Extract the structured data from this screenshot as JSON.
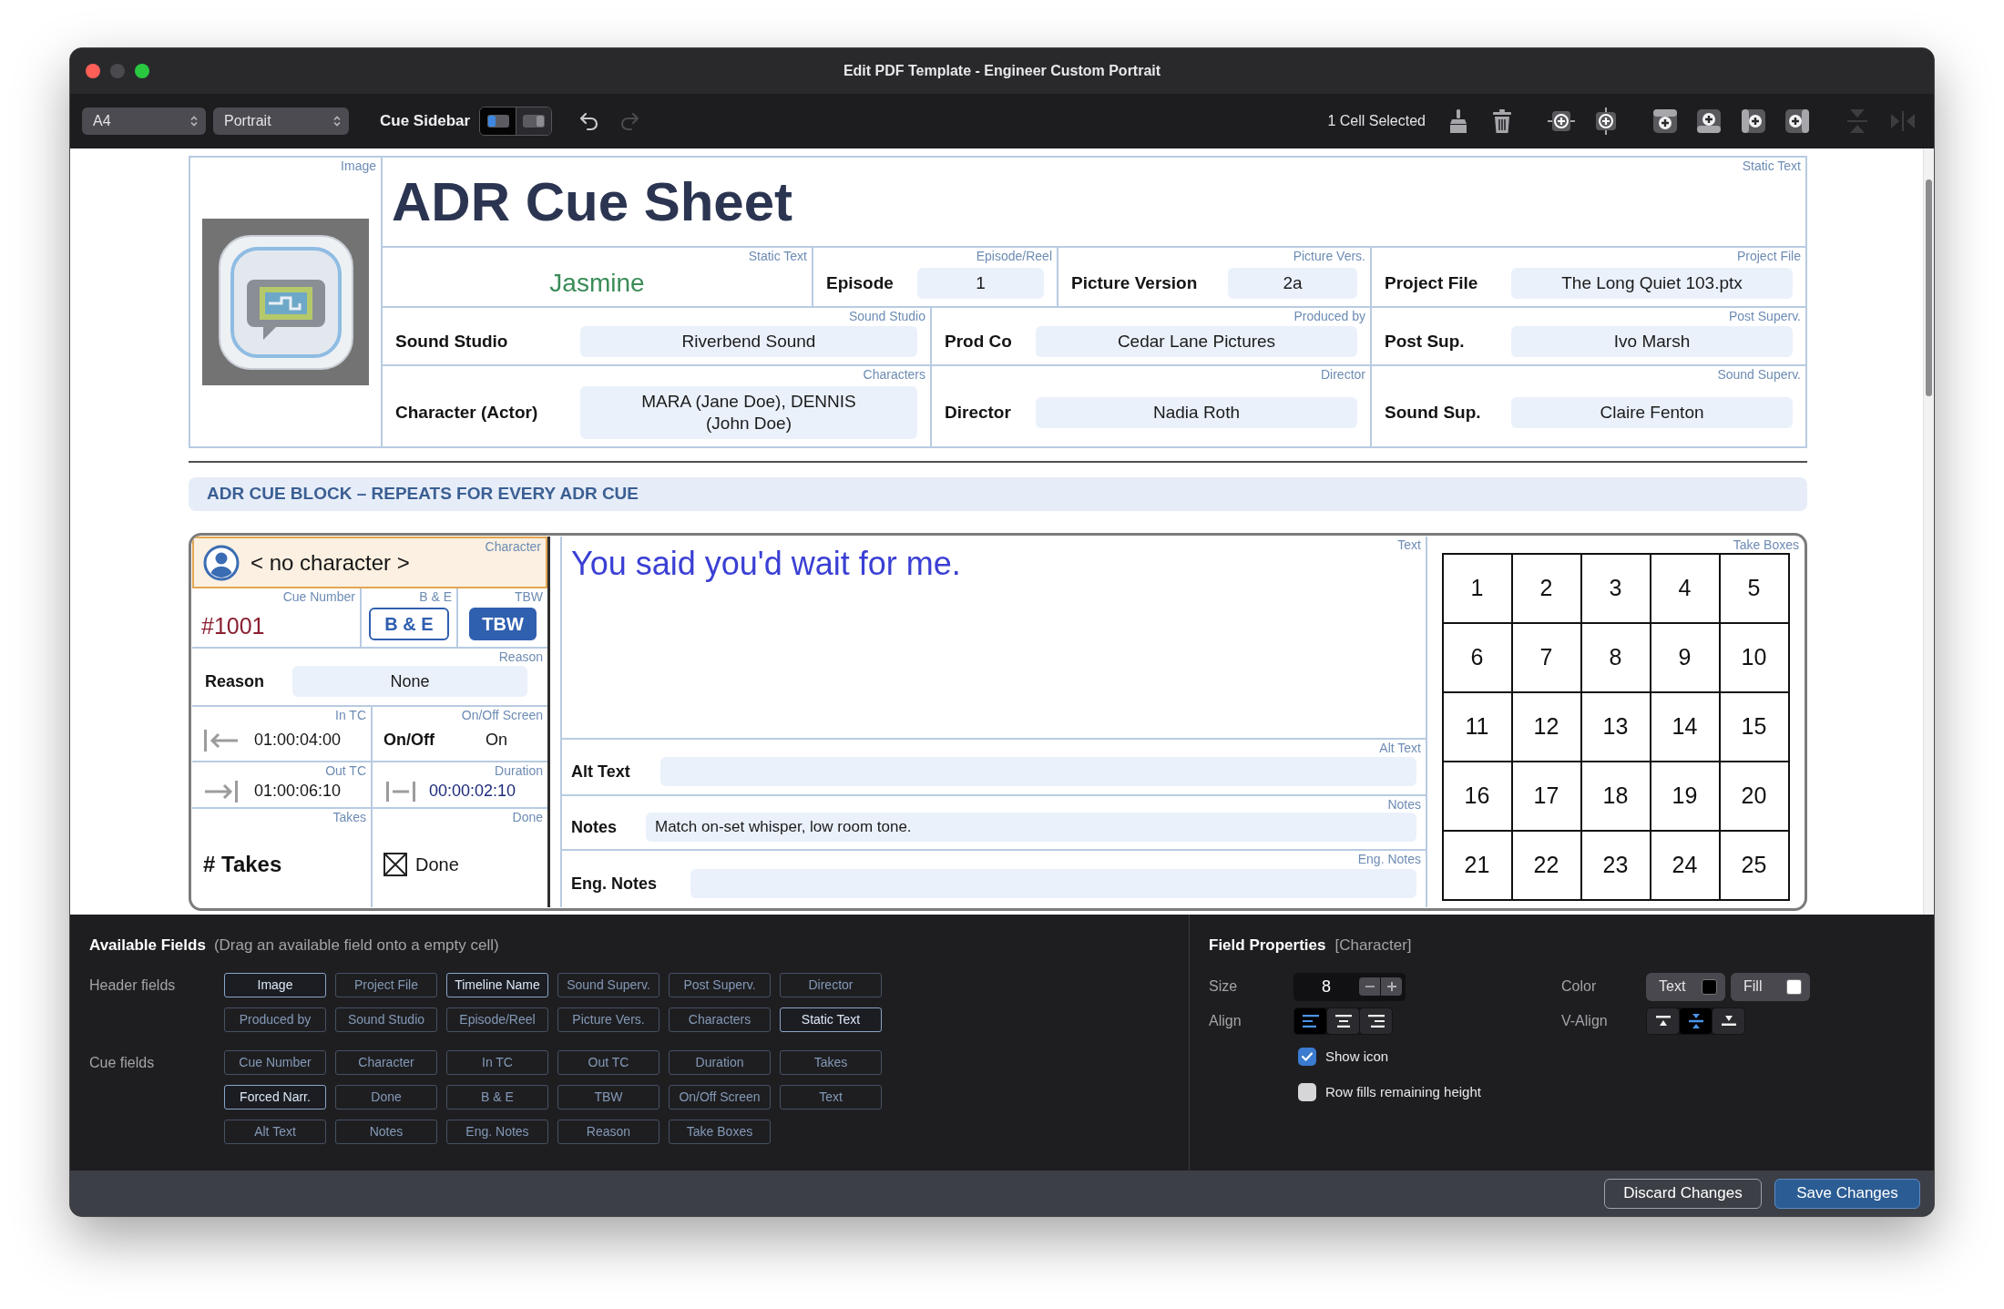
{
  "window": {
    "title": "Edit PDF Template - Engineer Custom Portrait"
  },
  "toolbar": {
    "paper_size": "A4",
    "orientation": "Portrait",
    "cue_sidebar": {
      "label": "Cue Sidebar",
      "options": [
        {
          "kind": "left",
          "selected": true
        },
        {
          "kind": "right",
          "selected": false
        }
      ]
    },
    "history": [
      {
        "kind": "undo",
        "disabled": false
      },
      {
        "kind": "redo",
        "disabled": true
      }
    ],
    "selection_status": "1 Cell Selected",
    "tools": [
      {
        "kind": "brush",
        "disabled": false
      },
      {
        "kind": "trash",
        "disabled": false
      },
      {
        "kind": "insert-h",
        "disabled": false
      },
      {
        "kind": "insert-v",
        "disabled": false
      },
      {
        "kind": "add-top",
        "disabled": false
      },
      {
        "kind": "add-bottom",
        "disabled": false
      },
      {
        "kind": "add-left",
        "disabled": false
      },
      {
        "kind": "add-right",
        "disabled": false
      },
      {
        "kind": "collapse-v",
        "disabled": true
      },
      {
        "kind": "collapse-h",
        "disabled": true
      }
    ]
  },
  "header": {
    "image": {
      "tag": "Image"
    },
    "title": {
      "text": "ADR Cue Sheet",
      "tag": "Static Text"
    },
    "rows": [
      [
        {
          "kind": "static",
          "text": "Jasmine",
          "tag": "Static Text"
        },
        {
          "kind": "field",
          "label": "Episode",
          "value": "1",
          "tag": "Episode/Reel",
          "colspan": 2
        },
        {
          "kind": "field",
          "label": "Picture Version",
          "value": "2a",
          "tag": "Picture Vers."
        },
        {
          "kind": "field",
          "label": "Project File",
          "value": "The Long Quiet 103.ptx",
          "tag": "Project File"
        }
      ],
      [
        {
          "kind": "field",
          "label": "Sound Studio",
          "value": "Riverbend Sound",
          "tag": "Sound Studio",
          "colspan": 2
        },
        {
          "kind": "field",
          "label": "Prod Co",
          "value": "Cedar Lane Pictures",
          "tag": "Produced by",
          "colspan": 2
        },
        {
          "kind": "field",
          "label": "Post Sup.",
          "value": "Ivo Marsh",
          "tag": "Post Superv."
        }
      ],
      [
        {
          "kind": "field",
          "label": "Character (Actor)",
          "value": "MARA (Jane Doe), DENNIS (John Doe)",
          "tag": "Characters",
          "colspan": 2
        },
        {
          "kind": "field",
          "label": "Director",
          "value": "Nadia Roth",
          "tag": "Director",
          "colspan": 2
        },
        {
          "kind": "field",
          "label": "Sound Sup.",
          "value": "Claire Fenton",
          "tag": "Sound Superv."
        }
      ]
    ]
  },
  "cue_block": {
    "banner": "ADR CUE BLOCK – REPEATS FOR EVERY ADR CUE",
    "character": {
      "text": "< no character >",
      "tag": "Character",
      "selected": true
    },
    "cue_number": {
      "value": "#1001",
      "tag": "Cue Number"
    },
    "b_and_e": {
      "label": "B & E",
      "tag": "B & E",
      "on": false
    },
    "tbw": {
      "label": "TBW",
      "tag": "TBW",
      "on": true
    },
    "reason": {
      "label": "Reason",
      "value": "None",
      "tag": "Reason"
    },
    "in_tc": {
      "value": "01:00:04:00",
      "tag": "In TC"
    },
    "on_off": {
      "label": "On/Off",
      "value": "On",
      "tag": "On/Off Screen"
    },
    "out_tc": {
      "value": "01:00:06:10",
      "tag": "Out TC"
    },
    "duration": {
      "value": "00:00:02:10",
      "tag": "Duration"
    },
    "takes": {
      "label": "# Takes",
      "tag": "Takes"
    },
    "done": {
      "label": "Done",
      "tag": "Done",
      "checked": true
    },
    "text": {
      "value": "You said you'd wait for me.",
      "tag": "Text"
    },
    "alt_text": {
      "label": "Alt Text",
      "tag": "Alt Text"
    },
    "notes": {
      "label": "Notes",
      "value": "Match on-set whisper, low room tone.",
      "tag": "Notes"
    },
    "eng_notes": {
      "label": "Eng. Notes",
      "tag": "Eng. Notes"
    },
    "take_boxes": {
      "tag": "Take Boxes",
      "boxes": [
        "1",
        "2",
        "3",
        "4",
        "5",
        "6",
        "7",
        "8",
        "9",
        "10",
        "11",
        "12",
        "13",
        "14",
        "15",
        "16",
        "17",
        "18",
        "19",
        "20",
        "21",
        "22",
        "23",
        "24",
        "25"
      ]
    }
  },
  "available_fields": {
    "title": "Available Fields",
    "hint": "(Drag an available field onto a empty cell)",
    "groups": [
      {
        "label": "Header fields",
        "fields": [
          {
            "label": "Image",
            "highlighted": true
          },
          {
            "label": "Project File",
            "highlighted": false
          },
          {
            "label": "Timeline Name",
            "highlighted": true
          },
          {
            "label": "Sound Superv.",
            "highlighted": false
          },
          {
            "label": "Post Superv.",
            "highlighted": false
          },
          {
            "label": "Director",
            "highlighted": false
          },
          {
            "label": "Produced by",
            "highlighted": false
          },
          {
            "label": "Sound Studio",
            "highlighted": false
          },
          {
            "label": "Episode/Reel",
            "highlighted": false
          },
          {
            "label": "Picture Vers.",
            "highlighted": false
          },
          {
            "label": "Characters",
            "highlighted": false
          },
          {
            "label": "Static Text",
            "highlighted": true
          }
        ]
      },
      {
        "label": "Cue fields",
        "fields": [
          {
            "label": "Cue Number",
            "highlighted": false
          },
          {
            "label": "Character",
            "highlighted": false
          },
          {
            "label": "In TC",
            "highlighted": false
          },
          {
            "label": "Out TC",
            "highlighted": false
          },
          {
            "label": "Duration",
            "highlighted": false
          },
          {
            "label": "Takes",
            "highlighted": false
          },
          {
            "label": "Forced Narr.",
            "highlighted": true
          },
          {
            "label": "Done",
            "highlighted": false
          },
          {
            "label": "B & E",
            "highlighted": false
          },
          {
            "label": "TBW",
            "highlighted": false
          },
          {
            "label": "On/Off Screen",
            "highlighted": false
          },
          {
            "label": "Text",
            "highlighted": false
          },
          {
            "label": "Alt Text",
            "highlighted": false
          },
          {
            "label": "Notes",
            "highlighted": false
          },
          {
            "label": "Eng. Notes",
            "highlighted": false
          },
          {
            "label": "Reason",
            "highlighted": false
          },
          {
            "label": "Take Boxes",
            "highlighted": false
          }
        ]
      }
    ]
  },
  "field_properties": {
    "title": "Field Properties",
    "target": "[Character]",
    "size": {
      "label": "Size",
      "value": "8"
    },
    "align": {
      "label": "Align",
      "options": [
        {
          "kind": "left",
          "selected": true
        },
        {
          "kind": "center",
          "selected": false
        },
        {
          "kind": "right",
          "selected": false
        }
      ]
    },
    "color": {
      "label": "Color",
      "options": [
        {
          "label": "Text",
          "color": "#000000"
        },
        {
          "label": "Fill",
          "color": "#ffffff"
        }
      ]
    },
    "v_align": {
      "label": "V-Align",
      "options": [
        {
          "kind": "top",
          "selected": false
        },
        {
          "kind": "middle",
          "selected": true
        },
        {
          "kind": "bottom",
          "selected": false
        }
      ]
    },
    "options": [
      {
        "label": "Show icon",
        "checked": true
      },
      {
        "label": "Row fills remaining height",
        "checked": false
      }
    ]
  },
  "footer": {
    "buttons": [
      {
        "label": "Discard Changes",
        "kind": "secondary"
      },
      {
        "label": "Save Changes",
        "kind": "primary"
      }
    ]
  }
}
